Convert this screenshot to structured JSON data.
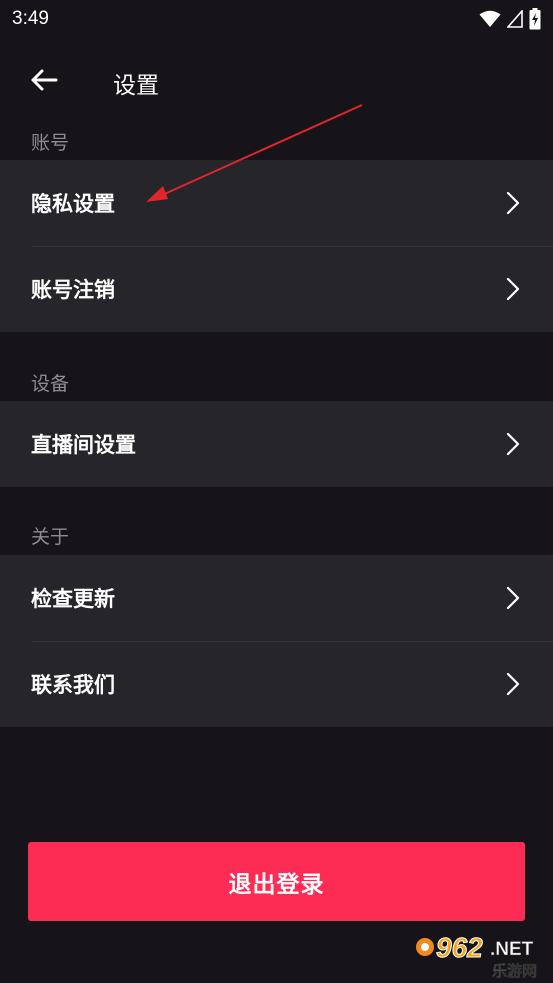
{
  "status_bar": {
    "time": "3:49",
    "icons": [
      "wifi-icon",
      "signal-icon",
      "battery-charging-icon"
    ]
  },
  "header": {
    "back_icon": "arrow-left-icon",
    "title": "设置"
  },
  "sections": [
    {
      "label": "账号",
      "items": [
        {
          "label": "隐私设置",
          "icon": "chevron-right-icon"
        },
        {
          "label": "账号注销",
          "icon": "chevron-right-icon"
        }
      ]
    },
    {
      "label": "设备",
      "items": [
        {
          "label": "直播间设置",
          "icon": "chevron-right-icon"
        }
      ]
    },
    {
      "label": "关于",
      "items": [
        {
          "label": "检查更新",
          "icon": "chevron-right-icon"
        },
        {
          "label": "联系我们",
          "icon": "chevron-right-icon"
        }
      ]
    }
  ],
  "logout_button": {
    "label": "退出登录"
  },
  "watermark": {
    "brand": "962",
    "suffix": ".NET",
    "subtitle": "乐游网"
  },
  "colors": {
    "background": "#161419",
    "group_background": "#262529",
    "section_label": "#8e8b92",
    "accent": "#fd2c55",
    "annotation_arrow": "#e0262b"
  }
}
